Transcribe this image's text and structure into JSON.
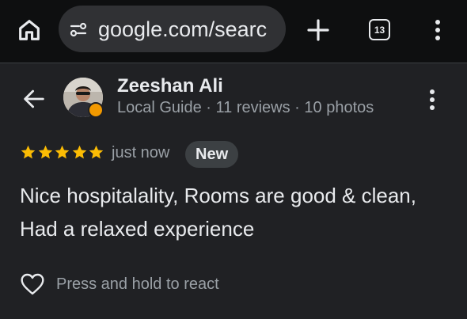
{
  "browser": {
    "url": "google.com/searc",
    "tab_count": "13",
    "icons": {
      "home": "home-icon",
      "site_info": "tune-icon",
      "new_tab": "plus-icon",
      "tabs": "tab-switcher-icon",
      "menu": "kebab-menu-icon"
    }
  },
  "review": {
    "reviewer": {
      "name": "Zeeshan Ali",
      "meta": "Local Guide · 11 reviews · 10 photos"
    },
    "rating": 5,
    "rating_stars": "★★★★★",
    "time": "just now",
    "badge": "New",
    "text": "Nice hospitalality, Rooms are good & clean, Had a relaxed experience",
    "react_label": "Press and hold to react"
  },
  "colors": {
    "background": "#202124",
    "toolbar": "#0e0f10",
    "omnibox": "#303134",
    "star": "#fbbc04",
    "secondary_text": "#9aa0a6",
    "badge_bg": "#3c4043"
  }
}
